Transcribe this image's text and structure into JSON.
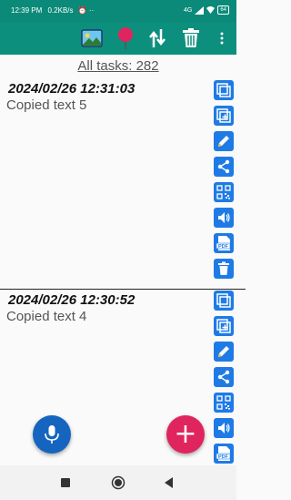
{
  "status_bar": {
    "time": "12:39 PM",
    "net_speed": "0.2KB/s",
    "extras": "⏰ ··",
    "signal": "4G",
    "battery": "64"
  },
  "toolbar": {
    "icons": [
      "image-icon",
      "pin-icon",
      "sort-icon",
      "trash-icon",
      "more-icon"
    ]
  },
  "summary": {
    "all_tasks_label": "All tasks: 282"
  },
  "entries": [
    {
      "timestamp": "2024/02/26 12:31:03",
      "text": "Copied text 5"
    },
    {
      "timestamp": "2024/02/26 12:30:52",
      "text": "Copied text 4"
    }
  ],
  "side_actions": {
    "icons": [
      "copy-icon",
      "add-icon",
      "edit-icon",
      "share-icon",
      "qr-icon",
      "speaker-icon",
      "pdf-icon",
      "delete-icon"
    ],
    "pdf_label": "PDF"
  },
  "fab": {
    "add_symbol": "+"
  },
  "colors": {
    "header": "#0d8f7d",
    "status": "#0b8a79",
    "accent_blue": "#1e7be6",
    "fab_add": "#e0245e",
    "fab_mic": "#1565c0"
  }
}
